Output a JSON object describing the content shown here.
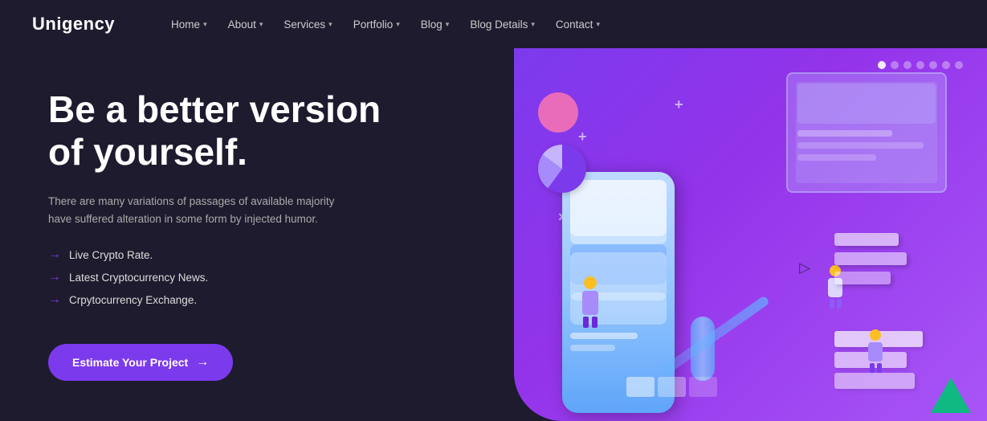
{
  "logo": {
    "first": "Uni",
    "second": "gency"
  },
  "nav": {
    "links": [
      {
        "label": "Home",
        "hasDropdown": true
      },
      {
        "label": "About",
        "hasDropdown": true
      },
      {
        "label": "Services",
        "hasDropdown": true
      },
      {
        "label": "Portfolio",
        "hasDropdown": true
      },
      {
        "label": "Blog",
        "hasDropdown": true
      },
      {
        "label": "Blog Details",
        "hasDropdown": true
      },
      {
        "label": "Contact",
        "hasDropdown": true
      }
    ]
  },
  "hero": {
    "heading_line1": "Be a better version",
    "heading_line2": "of yourself.",
    "description": "There are many variations of passages of available majority have suffered alteration in some form by injected humor.",
    "features": [
      "Live Crypto Rate.",
      "Latest Cryptocurrency News.",
      "Crpytocurrency Exchange."
    ],
    "cta_label": "Estimate Your Project",
    "cta_arrow": "→"
  },
  "dots": {
    "count": 7,
    "active_index": 0
  },
  "colors": {
    "brand_purple": "#7c3aed",
    "bg_dark": "#1e1b2e",
    "right_bg_start": "#7c3aed",
    "right_bg_end": "#a855f7"
  }
}
